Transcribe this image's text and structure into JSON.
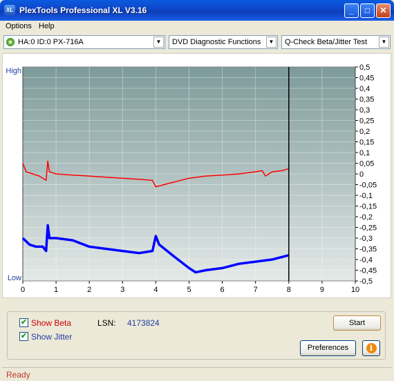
{
  "window": {
    "title": "PlexTools Professional XL V3.16",
    "icon_label": "XL"
  },
  "window_buttons": {
    "minimize": "_",
    "maximize": "□",
    "close": "✕"
  },
  "menu": {
    "items": [
      "Options",
      "Help"
    ]
  },
  "toolbar": {
    "drive": "HA:0 ID:0  PX-716A",
    "function": "DVD Diagnostic Functions",
    "test": "Q-Check Beta/Jitter Test",
    "dropdown_glyph": "▼"
  },
  "chart_data": {
    "type": "line",
    "left_axis_labels": {
      "top": "High",
      "bottom": "Low"
    },
    "x": {
      "min": 0,
      "max": 10,
      "ticks": [
        "0",
        "1",
        "2",
        "3",
        "4",
        "5",
        "6",
        "7",
        "8",
        "9",
        "10"
      ]
    },
    "right_axis": {
      "min": -0.5,
      "max": 0.5,
      "ticks": [
        "0,5",
        "0,45",
        "0,4",
        "0,35",
        "0,3",
        "0,25",
        "0,2",
        "0,15",
        "0,1",
        "0,05",
        "0",
        "-0,05",
        "-0,1",
        "-0,15",
        "-0,2",
        "-0,25",
        "-0,3",
        "-0,35",
        "-0,4",
        "-0,45",
        "-0,5"
      ]
    },
    "marker_x": 8,
    "grid": true,
    "series": [
      {
        "color": "#ff0000",
        "points": [
          [
            0,
            0.05
          ],
          [
            0.1,
            0.01
          ],
          [
            0.3,
            0
          ],
          [
            0.5,
            -0.01
          ],
          [
            0.7,
            -0.03
          ],
          [
            0.75,
            0.06
          ],
          [
            0.8,
            0.01
          ],
          [
            1.0,
            0.0
          ],
          [
            1.5,
            -0.005
          ],
          [
            2.0,
            -0.01
          ],
          [
            2.5,
            -0.015
          ],
          [
            3.0,
            -0.02
          ],
          [
            3.5,
            -0.025
          ],
          [
            3.9,
            -0.03
          ],
          [
            4.0,
            -0.06
          ],
          [
            4.5,
            -0.04
          ],
          [
            5.0,
            -0.02
          ],
          [
            5.5,
            -0.01
          ],
          [
            6.0,
            -0.005
          ],
          [
            6.5,
            0.0
          ],
          [
            7.0,
            0.01
          ],
          [
            7.2,
            0.015
          ],
          [
            7.3,
            -0.01
          ],
          [
            7.5,
            0.01
          ],
          [
            7.8,
            0.015
          ],
          [
            8.0,
            0.025
          ]
        ]
      },
      {
        "color": "#0000ff",
        "points": [
          [
            0,
            -0.3
          ],
          [
            0.2,
            -0.33
          ],
          [
            0.4,
            -0.34
          ],
          [
            0.6,
            -0.34
          ],
          [
            0.7,
            -0.36
          ],
          [
            0.75,
            -0.24
          ],
          [
            0.8,
            -0.3
          ],
          [
            1.0,
            -0.3
          ],
          [
            1.5,
            -0.31
          ],
          [
            2.0,
            -0.34
          ],
          [
            2.5,
            -0.35
          ],
          [
            3.0,
            -0.36
          ],
          [
            3.5,
            -0.37
          ],
          [
            3.9,
            -0.36
          ],
          [
            4.0,
            -0.29
          ],
          [
            4.1,
            -0.33
          ],
          [
            4.5,
            -0.38
          ],
          [
            5.0,
            -0.44
          ],
          [
            5.2,
            -0.46
          ],
          [
            5.5,
            -0.45
          ],
          [
            6.0,
            -0.44
          ],
          [
            6.5,
            -0.42
          ],
          [
            7.0,
            -0.41
          ],
          [
            7.5,
            -0.4
          ],
          [
            8.0,
            -0.38
          ]
        ]
      }
    ]
  },
  "controls": {
    "show_beta_label": "Show Beta",
    "show_jitter_label": "Show Jitter",
    "show_beta_checked": true,
    "show_jitter_checked": true,
    "lsn_label": "LSN:",
    "lsn_value": "4173824",
    "start_label": "Start",
    "preferences_label": "Preferences",
    "info_glyph": "i",
    "check_glyph": "✔"
  },
  "status": {
    "text": "Ready"
  },
  "colors": {
    "beta": "#ff0000",
    "jitter": "#0000ff",
    "lsn_value": "#1f3fa0",
    "status": "#c0392b",
    "plot_top": "#7d9a9a",
    "plot_bottom": "#e3e9e7"
  }
}
